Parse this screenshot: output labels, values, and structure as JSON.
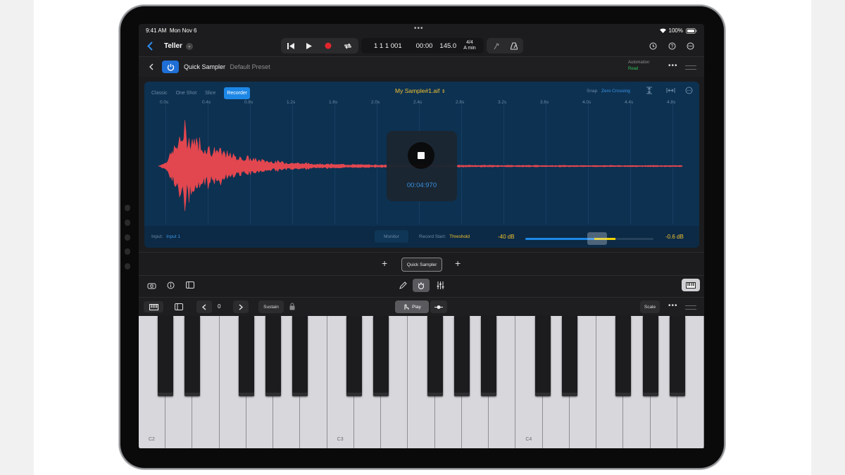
{
  "status": {
    "time": "9:41 AM",
    "date": "Mon Nov 6",
    "battery": "100%"
  },
  "toolbar": {
    "project": "Teller",
    "position_bars": "1 1 1 001",
    "time_counter": "00:00",
    "tempo": "145.0",
    "time_signature": "4/4",
    "key": "A min"
  },
  "plugin": {
    "name": "Quick Sampler",
    "preset": "Default Preset",
    "automation_label": "Automation",
    "automation_mode": "Read"
  },
  "sampler": {
    "modes": [
      "Classic",
      "One Shot",
      "Slice",
      "Recorder"
    ],
    "active_mode": "Recorder",
    "file_name": "My Sample#1.aif",
    "snap_label": "Snap",
    "snap_value": "Zero Crossing",
    "ruler": [
      "0.0s",
      "0.4s",
      "0.8s",
      "1.2s",
      "1.6s",
      "2.0s",
      "2.4s",
      "2.8s",
      "3.2s",
      "3.6s",
      "4.0s",
      "4.4s",
      "4.8s"
    ],
    "record_time": "00:04:970",
    "input_label": "Input:",
    "input_value": "Input 1",
    "monitor_label": "Monitor",
    "record_start_label": "Record Start:",
    "record_start_value": "Threshold",
    "threshold_db": "-40 dB",
    "level_db": "-0.6 dB",
    "meter_level": 0.56
  },
  "footer": {
    "instrument_tab": "Quick Sampler"
  },
  "keyboard": {
    "octave_value": "0",
    "sustain_label": "Sustain",
    "play_label": "Play",
    "scale_label": "Scale",
    "octave_labels": [
      "C2",
      "C3",
      "C4"
    ]
  },
  "colors": {
    "accent": "#1d87e6",
    "waveform": "#e2474f",
    "record": "#e0262b",
    "automation": "#30c25a",
    "sampler_bg": "#0d3151",
    "level_text": "#f1c232"
  }
}
